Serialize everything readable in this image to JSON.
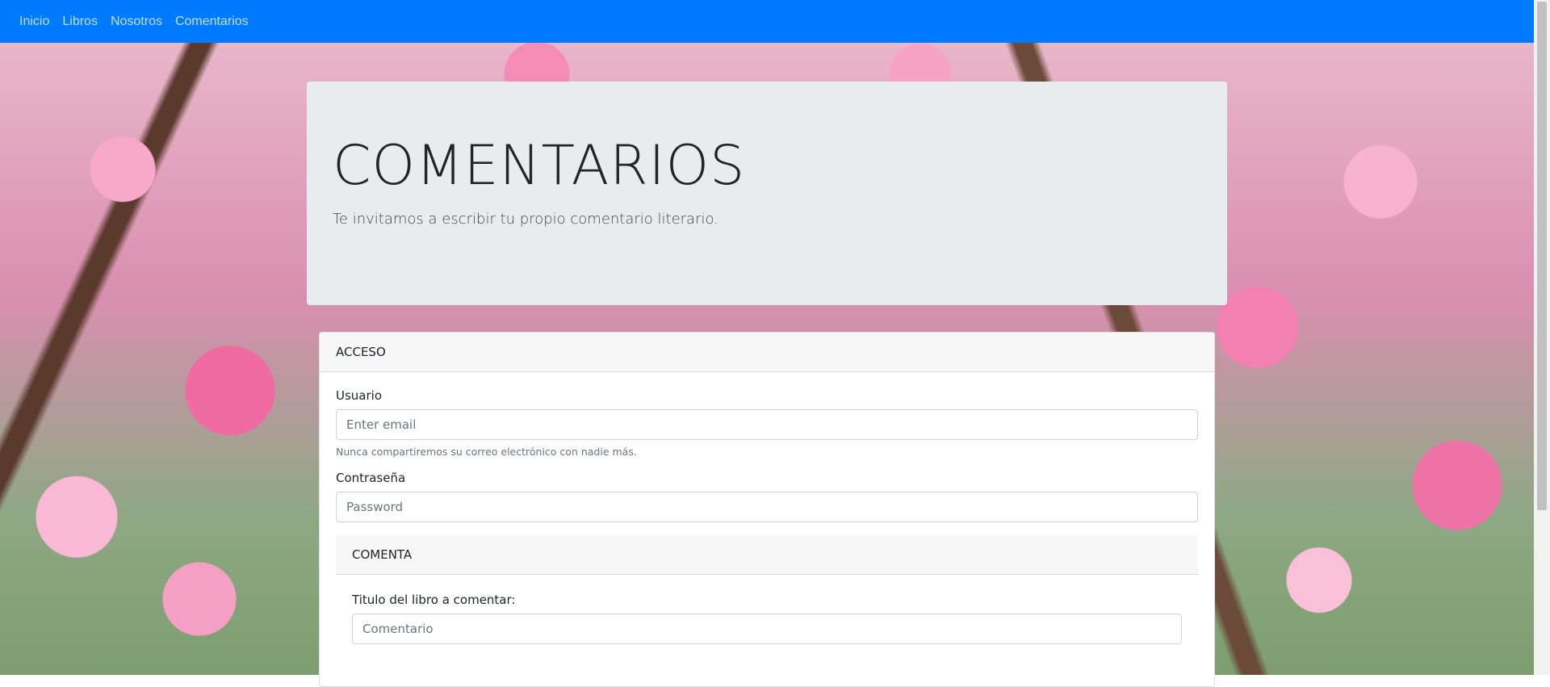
{
  "nav": {
    "items": [
      "Inicio",
      "Libros",
      "Nosotros",
      "Comentarios"
    ]
  },
  "jumbotron": {
    "title": "COMENTARIOS",
    "lead": "Te invitamos a escribir tu propio comentario literario."
  },
  "access_card": {
    "header": "ACCESO",
    "user_label": "Usuario",
    "user_placeholder": "Enter email",
    "user_help": "Nunca compartiremos su correo electrónico con nadie más.",
    "password_label": "Contraseña",
    "password_placeholder": "Password"
  },
  "comment_card": {
    "header": "COMENTA",
    "title_label": "Titulo del libro a comentar:",
    "title_placeholder": "Comentario"
  },
  "colors": {
    "navbar": "#007bff",
    "jumbotron": "#e9ecef",
    "card_header": "#f7f7f7"
  }
}
